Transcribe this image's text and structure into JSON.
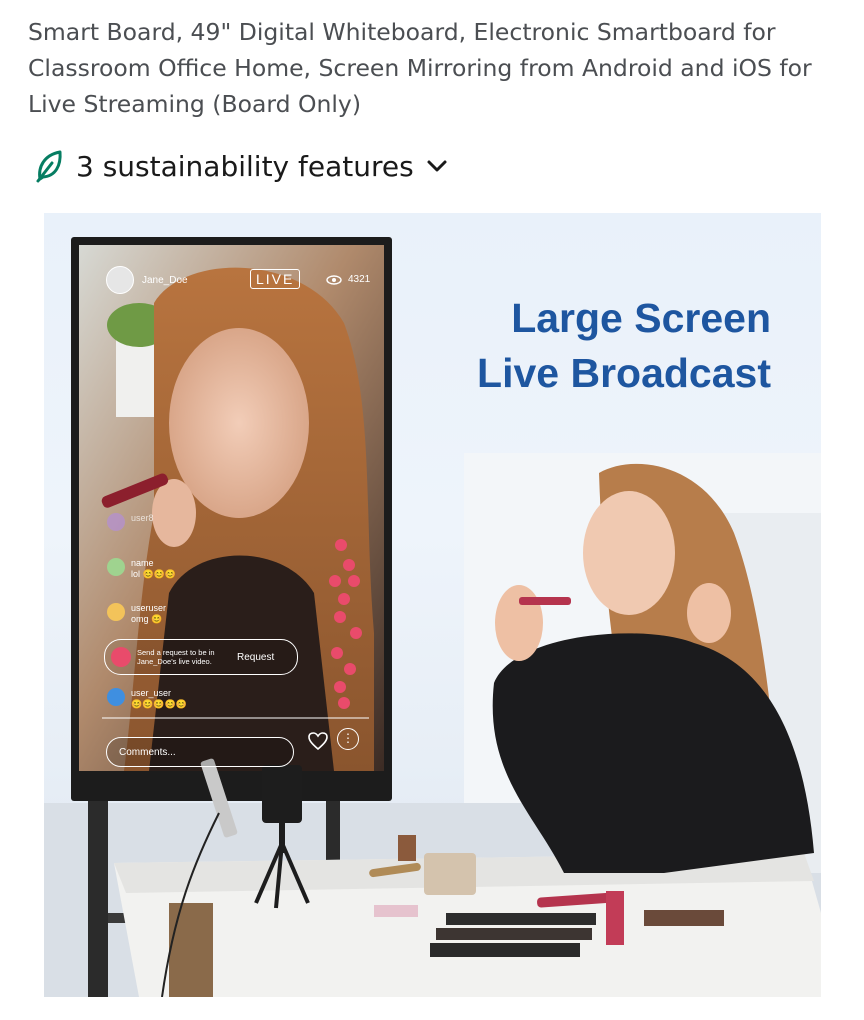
{
  "product": {
    "title": "Smart Board, 49\" Digital Whiteboard, Electronic Smartboard for Classroom Office Home, Screen Mirroring from Android and iOS for Live Streaming (Board Only)"
  },
  "sustainability": {
    "label": "3 sustainability features",
    "accent": "#067d62",
    "icon": "leaf-icon",
    "expand_icon": "chevron-down-icon"
  },
  "hero": {
    "headline_line1": "Large Screen",
    "headline_line2": "Live Broadcast",
    "headline_color": "#1e56a0",
    "stream": {
      "username": "Jane_Doe",
      "live_badge": "LIVE",
      "viewer_count": "4321",
      "comments": [
        {
          "user": "user8",
          "text": ""
        },
        {
          "user": "name",
          "text": "lol 😊😊😊"
        },
        {
          "user": "useruser",
          "text": "omg 😊"
        },
        {
          "user": "user_user",
          "text": "😊😊😊😊😊"
        }
      ],
      "request_text": "Send a request to be in Jane_Doe's live video.",
      "request_button": "Request",
      "comment_placeholder": "Comments..."
    }
  }
}
